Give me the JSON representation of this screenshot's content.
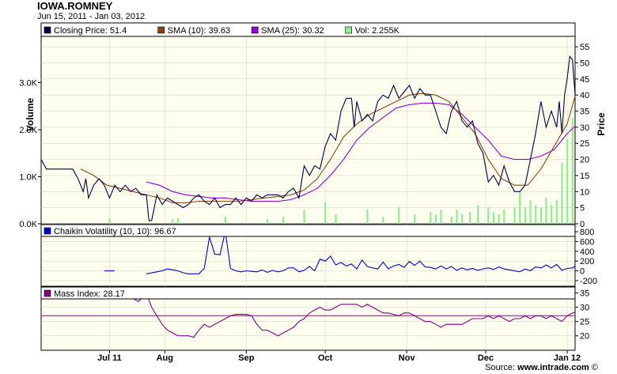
{
  "header": {
    "title": "IOWA.ROMNEY",
    "date_range": "Jun 15, 2011 - Jan 03, 2012",
    "source_prefix": "Source: ",
    "source_site": "www.intrade.com",
    "source_suffix": " ©"
  },
  "colors": {
    "panel_bg": "#fffff0",
    "border": "#000000",
    "price": "#000040",
    "sma10": "#8b4513",
    "sma25": "#9400d3",
    "volume": "#90ee90",
    "chaikin": "#0000cc",
    "mass_index": "#800080",
    "mass_ref": "#c040c0",
    "grid": "#cccccc"
  },
  "chart_data": [
    {
      "type": "line",
      "panel": "price",
      "ylabel": "Price",
      "y2label": "Volume",
      "ylim": [
        0,
        57
      ],
      "yticks": [
        "0",
        "5",
        "10",
        "15",
        "20",
        "25",
        "30",
        "35",
        "40",
        "45",
        "50",
        "55"
      ],
      "volume_ylim": [
        0,
        3900
      ],
      "volume_ticks": [
        "0.0K",
        "1.0K",
        "2.0K",
        "3.0K"
      ],
      "xlim_days": [
        0,
        203
      ],
      "xticks": [
        {
          "label": "Jul 11",
          "day": 26
        },
        {
          "label": "Aug",
          "day": 47
        },
        {
          "label": "Sep",
          "day": 78
        },
        {
          "label": "Oct",
          "day": 108
        },
        {
          "label": "Nov",
          "day": 139
        },
        {
          "label": "Dec",
          "day": 169
        },
        {
          "label": "Jan 12",
          "day": 200
        }
      ],
      "legend": [
        {
          "name": "Closing Price: 51.4",
          "color": "#000040"
        },
        {
          "name": "SMA (10): 39.63",
          "color": "#8b4513"
        },
        {
          "name": "SMA (25): 30.32",
          "color": "#9400d3"
        },
        {
          "name": "Vol: 2.255K",
          "color": "#90ee90"
        }
      ],
      "series": [
        {
          "name": "Closing Price",
          "color": "#000040",
          "x": [
            0,
            2,
            3,
            5,
            8,
            10,
            12,
            14,
            15,
            16,
            17,
            18,
            20,
            22,
            24,
            26,
            28,
            30,
            32,
            34,
            36,
            38,
            40,
            41,
            42,
            44,
            46,
            48,
            50,
            52,
            54,
            56,
            58,
            60,
            62,
            64,
            66,
            68,
            70,
            72,
            74,
            76,
            78,
            80,
            82,
            84,
            86,
            88,
            90,
            92,
            94,
            96,
            98,
            100,
            102,
            104,
            106,
            108,
            110,
            112,
            114,
            116,
            118,
            119,
            120,
            122,
            124,
            126,
            128,
            130,
            132,
            134,
            136,
            138,
            140,
            142,
            144,
            146,
            148,
            150,
            152,
            154,
            156,
            158,
            160,
            162,
            164,
            166,
            168,
            170,
            172,
            174,
            176,
            178,
            180,
            182,
            184,
            186,
            188,
            190,
            192,
            194,
            196,
            197,
            198,
            199,
            200,
            201,
            202,
            203
          ],
          "y": [
            20,
            17,
            17,
            17,
            17,
            17,
            17,
            14,
            12,
            10,
            14,
            8,
            12,
            14,
            12,
            8,
            12,
            10,
            12,
            10,
            11,
            9,
            9,
            1,
            1,
            9,
            6,
            8,
            7,
            6,
            5,
            6,
            8,
            9,
            7,
            6,
            8,
            5,
            6,
            6,
            8,
            6,
            8,
            7,
            9,
            8,
            9,
            9,
            9,
            8,
            10,
            11,
            8,
            18,
            15,
            18,
            17,
            24,
            28,
            26,
            35,
            39,
            39,
            30,
            38,
            32,
            34,
            32,
            38,
            40,
            39,
            43,
            39,
            41,
            43,
            39,
            42,
            40,
            40,
            35,
            30,
            28,
            35,
            38,
            32,
            30,
            32,
            25,
            22,
            13,
            15,
            12,
            18,
            13,
            10,
            10,
            12,
            20,
            28,
            38,
            30,
            35,
            30,
            38,
            28,
            40,
            45,
            52,
            51,
            40
          ]
        },
        {
          "name": "SMA (10)",
          "color": "#8b4513",
          "x": [
            15,
            20,
            25,
            30,
            35,
            40,
            45,
            50,
            55,
            60,
            65,
            70,
            75,
            80,
            85,
            90,
            95,
            100,
            105,
            110,
            115,
            120,
            125,
            130,
            135,
            140,
            145,
            150,
            155,
            160,
            165,
            170,
            175,
            180,
            185,
            190,
            195,
            200,
            203
          ],
          "y": [
            17,
            15,
            12,
            11,
            10,
            9,
            8,
            6.5,
            6.5,
            7,
            7,
            7,
            7,
            7.5,
            8,
            8.5,
            9,
            10.5,
            14,
            20,
            27,
            31,
            34,
            36,
            38,
            40,
            40.5,
            40,
            38,
            33,
            28,
            20,
            14,
            12,
            12,
            17,
            24,
            31,
            39.63
          ]
        },
        {
          "name": "SMA (25)",
          "color": "#9400d3",
          "x": [
            40,
            45,
            50,
            55,
            60,
            65,
            70,
            75,
            80,
            85,
            90,
            95,
            100,
            105,
            110,
            115,
            120,
            125,
            130,
            135,
            140,
            145,
            150,
            155,
            160,
            165,
            170,
            175,
            180,
            185,
            190,
            195,
            200,
            203
          ],
          "y": [
            13,
            12,
            10,
            9,
            8.5,
            8,
            8,
            7.5,
            7,
            7,
            7,
            7.5,
            9,
            11,
            15,
            20,
            26,
            30,
            33,
            36,
            37,
            37.5,
            37.5,
            37,
            34,
            30,
            26,
            21,
            20,
            20,
            21,
            23,
            28,
            30.32
          ]
        },
        {
          "name": "Volume",
          "color": "#90ee90",
          "x": [
            26,
            50,
            52,
            70,
            86,
            92,
            100,
            108,
            112,
            124,
            130,
            136,
            142,
            148,
            150,
            152,
            156,
            158,
            160,
            163,
            166,
            170,
            172,
            174,
            176,
            180,
            182,
            184,
            186,
            188,
            190,
            192,
            194,
            196,
            198,
            200,
            202
          ],
          "y": [
            120,
            100,
            120,
            150,
            100,
            150,
            300,
            450,
            200,
            300,
            150,
            350,
            200,
            250,
            200,
            300,
            150,
            300,
            200,
            250,
            400,
            350,
            250,
            200,
            300,
            350,
            700,
            350,
            500,
            400,
            350,
            550,
            400,
            500,
            1300,
            1800,
            2255
          ]
        }
      ]
    },
    {
      "type": "line",
      "panel": "chaikin",
      "ylim": [
        -250,
        850
      ],
      "yticks": [
        "800",
        "600",
        "400",
        "200",
        "0",
        "-200"
      ],
      "legend": [
        {
          "name": "Chaikin Volatility (10, 10): 96.67",
          "color": "#0000cc"
        }
      ],
      "series": [
        {
          "name": "Chaikin Volatility",
          "color": "#0000cc",
          "x": [
            24,
            25,
            26,
            27,
            36,
            40,
            44,
            46,
            48,
            50,
            52,
            56,
            60,
            66,
            70,
            72,
            74,
            76,
            78,
            80,
            82,
            84,
            86,
            88,
            92,
            94,
            96,
            98,
            100,
            104,
            106,
            108,
            110,
            112,
            114,
            116,
            118,
            120,
            124,
            128,
            132,
            136,
            140,
            144,
            150,
            156,
            162,
            168,
            174,
            180,
            186,
            190,
            194,
            198,
            203
          ],
          "y": [
            0,
            0,
            0,
            0,
            -50,
            -60,
            -20,
            0,
            -40,
            -60,
            -40,
            -30,
            -60,
            -60,
            -60,
            50,
            200,
            350,
            200,
            50,
            -20,
            0,
            20,
            -10,
            -50,
            -30,
            0,
            20,
            -20,
            50,
            0,
            30,
            -20,
            20,
            0,
            40,
            20,
            100,
            20,
            80,
            50,
            100,
            20,
            70,
            20,
            60,
            -20,
            10,
            -40,
            30,
            -20,
            40,
            10,
            50,
            96.67
          ]
        },
        {
          "name": "Chaikin Volatility",
          "color": "#0000cc",
          "x": [
            40,
            42,
            44,
            46,
            47,
            48,
            50,
            52,
            54,
            56,
            58,
            60,
            62,
            64,
            66,
            68,
            70,
            72,
            74,
            76,
            78,
            80,
            82,
            84,
            86,
            88,
            90,
            92,
            94,
            96,
            98,
            100,
            102,
            104,
            106,
            108,
            110,
            112,
            114,
            116,
            118,
            120,
            122,
            124,
            126,
            128,
            130,
            132,
            134,
            136,
            138,
            140,
            142,
            144,
            146,
            148,
            150,
            152,
            154,
            156,
            158,
            160,
            162,
            164,
            166,
            168,
            170,
            172,
            174,
            176,
            178,
            180,
            182,
            184,
            186,
            188,
            190,
            192,
            194,
            196,
            198,
            200,
            202,
            203
          ],
          "y": [
            -60,
            -40,
            -20,
            0,
            20,
            40,
            20,
            0,
            -40,
            -60,
            -60,
            -60,
            50,
            690,
            340,
            330,
            800,
            50,
            0,
            -20,
            0,
            -10,
            -20,
            20,
            -30,
            10,
            -20,
            0,
            60,
            60,
            -20,
            10,
            90,
            0,
            240,
            200,
            300,
            120,
            170,
            100,
            140,
            40,
            220,
            90,
            60,
            40,
            180,
            40,
            100,
            130,
            70,
            190,
            110,
            200,
            80,
            70,
            40,
            100,
            40,
            90,
            10,
            60,
            20,
            50,
            10,
            40,
            60,
            30,
            80,
            40,
            20,
            0,
            -20,
            40,
            0,
            80,
            60,
            120,
            60,
            130,
            10,
            50,
            60,
            96.67
          ]
        }
      ]
    },
    {
      "type": "line",
      "panel": "mass_index",
      "ylim": [
        15.5,
        36.5
      ],
      "yticks": [
        "35",
        "30",
        "25",
        "20"
      ],
      "reference_line": 27,
      "legend": [
        {
          "name": "Mass Index: 28.17",
          "color": "#800080"
        }
      ],
      "series": [
        {
          "name": "Mass Index",
          "color": "#800080",
          "x": [
            33,
            35,
            37,
            38,
            40,
            42,
            44,
            46,
            48,
            50,
            52,
            54,
            56,
            58,
            60,
            62,
            64,
            66,
            68,
            70,
            72,
            74,
            76,
            78,
            80,
            82,
            84,
            86,
            88,
            90,
            92,
            94,
            96,
            98,
            100,
            102,
            104,
            106,
            108,
            110,
            112,
            114,
            116,
            118,
            120,
            122,
            124,
            126,
            128,
            130,
            132,
            134,
            136,
            138,
            140,
            142,
            144,
            146,
            148,
            150,
            152,
            154,
            156,
            158,
            160,
            162,
            164,
            166,
            168,
            170,
            172,
            174,
            176,
            178,
            180,
            182,
            184,
            186,
            188,
            190,
            192,
            194,
            196,
            198,
            200,
            202,
            203
          ],
          "y": [
            34,
            33,
            32,
            33,
            35,
            30,
            27,
            24,
            22,
            21,
            20,
            20,
            20,
            19.5,
            22,
            24,
            23,
            24,
            25,
            26,
            27,
            27.5,
            27.5,
            27.5,
            27,
            24,
            22,
            22,
            21,
            20,
            21,
            22,
            23,
            25,
            26,
            28,
            29,
            30,
            29,
            29,
            30,
            31,
            31,
            31,
            31,
            30,
            31,
            30,
            29,
            28,
            28,
            27.5,
            27,
            28,
            28,
            27,
            26,
            25,
            25,
            24,
            23,
            24,
            24,
            24,
            24,
            25,
            26,
            26,
            26,
            27,
            26,
            27,
            26,
            25,
            26,
            26,
            27,
            26,
            27,
            27,
            26,
            27,
            26,
            25,
            27,
            28,
            28.17
          ]
        }
      ]
    }
  ]
}
